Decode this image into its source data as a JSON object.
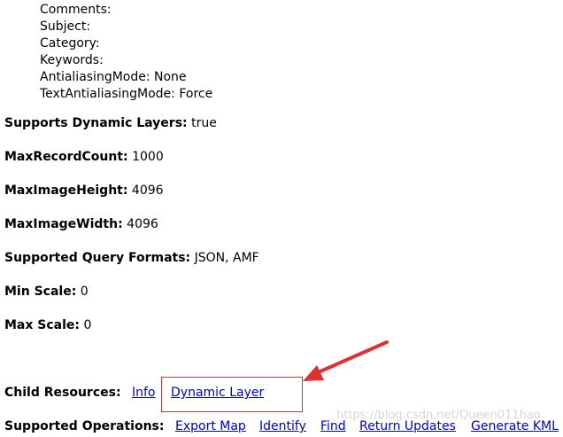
{
  "document_info": {
    "comments": "Comments:",
    "subject": "Subject:",
    "category": "Category:",
    "keywords": "Keywords:",
    "antialiasing_mode": "AntialiasingMode: None",
    "text_antialiasing_mode": "TextAntialiasingMode: Force"
  },
  "properties": {
    "supports_dynamic_layers_label": "Supports Dynamic Layers:",
    "supports_dynamic_layers_value": "true",
    "max_record_count_label": "MaxRecordCount:",
    "max_record_count_value": "1000",
    "max_image_height_label": "MaxImageHeight:",
    "max_image_height_value": "4096",
    "max_image_width_label": "MaxImageWidth:",
    "max_image_width_value": "4096",
    "supported_query_formats_label": "Supported Query Formats:",
    "supported_query_formats_value": "JSON, AMF",
    "min_scale_label": "Min Scale:",
    "min_scale_value": "0",
    "max_scale_label": "Max Scale:",
    "max_scale_value": "0"
  },
  "child_resources": {
    "label": "Child Resources:",
    "links": [
      "Info",
      "Dynamic Layer"
    ]
  },
  "supported_operations": {
    "label": "Supported Operations:",
    "links": [
      "Export Map",
      "Identify",
      "Find",
      "Return Updates",
      "Generate KML"
    ]
  },
  "annotation": {
    "color": "#e03030",
    "watermark": "https://blog.csdn.net/Queen011hao"
  }
}
